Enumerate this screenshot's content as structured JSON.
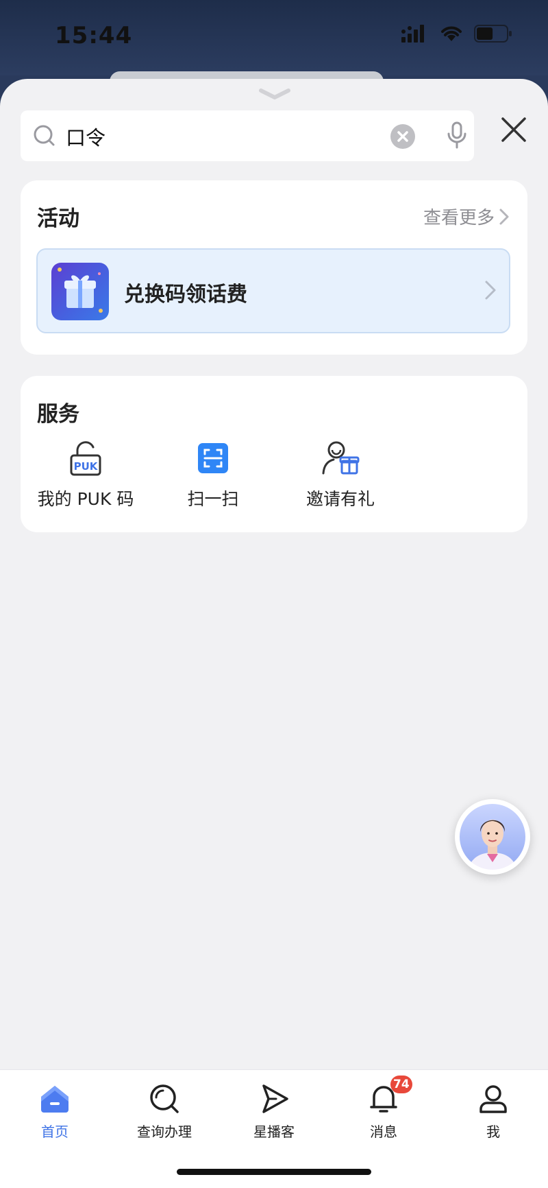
{
  "status_bar": {
    "time": "15:44",
    "battery_level": 0.55
  },
  "search": {
    "value": "口令",
    "icons": [
      "search-icon",
      "clear-icon",
      "mic-icon"
    ]
  },
  "close_icon": "close-icon",
  "activity": {
    "title": "活动",
    "more_label": "查看更多",
    "items": [
      {
        "label": "兑换码领话费",
        "icon": "gift-icon"
      }
    ]
  },
  "services": {
    "title": "服务",
    "items": [
      {
        "label": "我的 PUK 码",
        "icon": "puk-lock-icon"
      },
      {
        "label": "扫一扫",
        "icon": "scan-icon"
      },
      {
        "label": "邀请有礼",
        "icon": "invite-gift-icon"
      }
    ]
  },
  "assistant": {
    "icon": "assistant-avatar"
  },
  "tabbar": {
    "tabs": [
      {
        "label": "首页",
        "icon": "home-icon",
        "active": true
      },
      {
        "label": "查询办理",
        "icon": "query-icon",
        "active": false
      },
      {
        "label": "星播客",
        "icon": "send-icon",
        "active": false
      },
      {
        "label": "消息",
        "icon": "bell-icon",
        "active": false,
        "badge": "74"
      },
      {
        "label": "我",
        "icon": "profile-icon",
        "active": false
      }
    ]
  },
  "colors": {
    "accent": "#3f73e6",
    "badge": "#e8483a",
    "sheet_bg": "#f1f1f3"
  }
}
